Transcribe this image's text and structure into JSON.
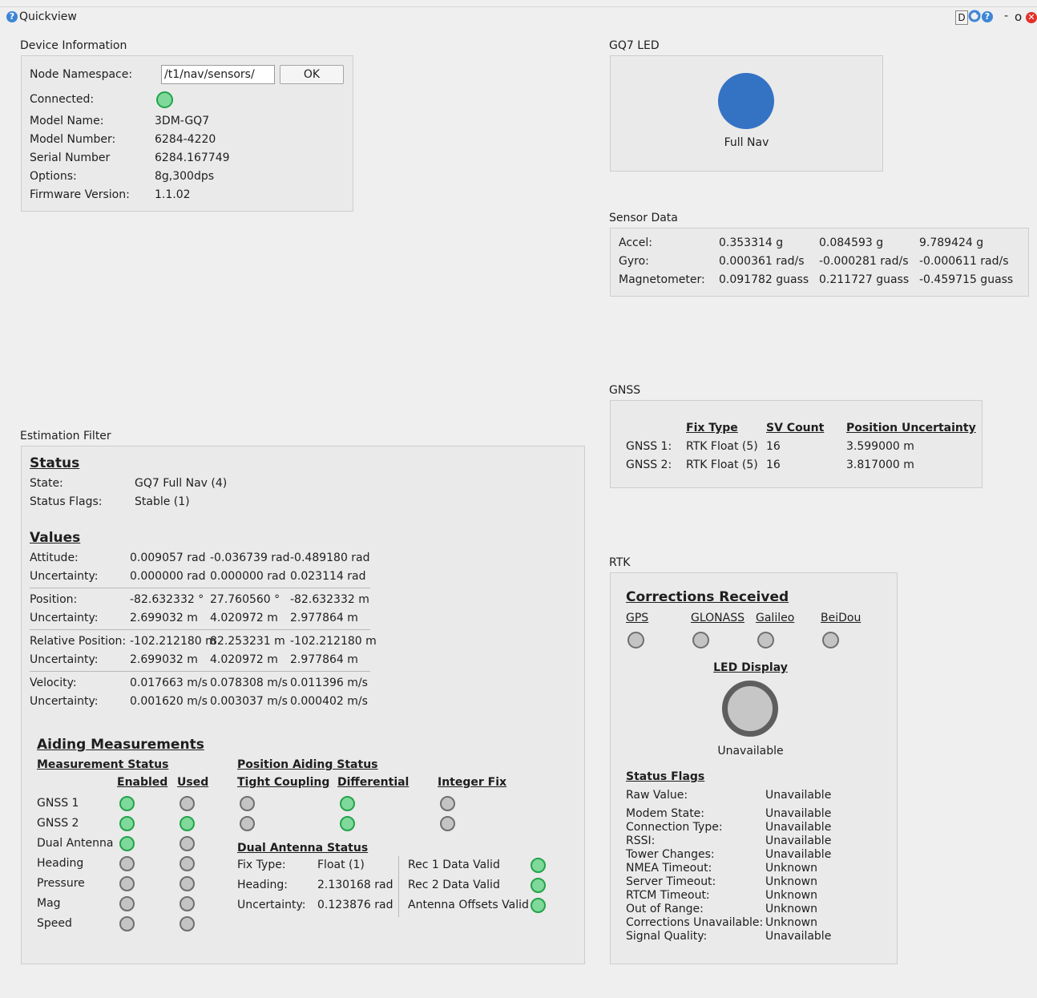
{
  "window": {
    "title": "Quickview",
    "right_label_d": "D",
    "minimize": "-",
    "restore": "o"
  },
  "device_info": {
    "group_title": "Device Information",
    "namespace_label": "Node Namespace:",
    "namespace_value": "/t1/nav/sensors/",
    "ok_label": "OK",
    "connected_label": "Connected:",
    "connected_status": "green",
    "rows": [
      {
        "label": "Model Name:",
        "value": "3DM-GQ7"
      },
      {
        "label": "Model Number:",
        "value": "6284-4220"
      },
      {
        "label": "Serial Number",
        "value": "6284.167749"
      },
      {
        "label": "Options:",
        "value": "8g,300dps"
      },
      {
        "label": "Firmware Version:",
        "value": "1.1.02"
      }
    ]
  },
  "gq7_led": {
    "group_title": "GQ7 LED",
    "color": "#3472c4",
    "label": "Full Nav"
  },
  "sensor_data": {
    "group_title": "Sensor Data",
    "rows": [
      {
        "label": "Accel:",
        "x": "0.353314 g",
        "y": "0.084593 g",
        "z": "9.789424 g"
      },
      {
        "label": "Gyro:",
        "x": "0.000361 rad/s",
        "y": "-0.000281 rad/s",
        "z": "-0.000611 rad/s"
      },
      {
        "label": "Magnetometer:",
        "x": "0.091782 guass",
        "y": "0.211727 guass",
        "z": "-0.459715 guass"
      }
    ]
  },
  "gnss": {
    "group_title": "GNSS",
    "headers": [
      "Fix Type",
      "SV Count",
      "Position Uncertainty"
    ],
    "rows": [
      {
        "label": "GNSS 1:",
        "fix": "RTK Float (5)",
        "sv": "16",
        "unc": "3.599000 m"
      },
      {
        "label": "GNSS 2:",
        "fix": "RTK Float (5)",
        "sv": "16",
        "unc": "3.817000 m"
      }
    ]
  },
  "estimation_filter": {
    "group_title": "Estimation Filter",
    "status_header": "Status",
    "state_label": "State:",
    "state_value": "GQ7 Full Nav (4)",
    "flags_label": "Status Flags:",
    "flags_value": "Stable (1)",
    "values_header": "Values",
    "rows": [
      {
        "label": "Attitude:",
        "v": [
          "0.009057 rad",
          "-0.036739 rad",
          "-0.489180 rad"
        ]
      },
      {
        "label": "Uncertainty:",
        "v": [
          "0.000000 rad",
          "0.000000 rad",
          "0.023114 rad"
        ]
      },
      {
        "label": "Position:",
        "v": [
          "-82.632332 °",
          "27.760560 °",
          "-82.632332 m"
        ]
      },
      {
        "label": "Uncertainty:",
        "v": [
          "2.699032 m",
          "4.020972 m",
          "2.977864 m"
        ]
      },
      {
        "label": "Relative Position:",
        "v": [
          "-102.212180 m",
          "82.253231 m",
          "-102.212180 m"
        ]
      },
      {
        "label": "Uncertainty:",
        "v": [
          "2.699032 m",
          "4.020972 m",
          "2.977864 m"
        ]
      },
      {
        "label": "Velocity:",
        "v": [
          "0.017663 m/s",
          "0.078308 m/s",
          "0.011396 m/s"
        ]
      },
      {
        "label": "Uncertainty:",
        "v": [
          "0.001620 m/s",
          "0.003037 m/s",
          "0.000402 m/s"
        ]
      }
    ],
    "aiding": {
      "header": "Aiding Measurements",
      "measurement_status": "Measurement Status",
      "enabled": "Enabled",
      "used": "Used",
      "position_aiding_status": "Position Aiding Status",
      "tight_coupling": "Tight Coupling",
      "differential": "Differential",
      "integer_fix": "Integer Fix",
      "rows": [
        {
          "label": "GNSS 1",
          "enabled": "green",
          "used": "gray"
        },
        {
          "label": "GNSS 2",
          "enabled": "green",
          "used": "green"
        },
        {
          "label": "Dual Antenna",
          "enabled": "green",
          "used": "gray"
        },
        {
          "label": "Heading",
          "enabled": "gray",
          "used": "gray"
        },
        {
          "label": "Pressure",
          "enabled": "gray",
          "used": "gray"
        },
        {
          "label": "Mag",
          "enabled": "gray",
          "used": "gray"
        },
        {
          "label": "Speed",
          "enabled": "gray",
          "used": "gray"
        }
      ],
      "pos_rows": [
        {
          "tight": "gray",
          "diff": "green",
          "int": "gray"
        },
        {
          "tight": "gray",
          "diff": "green",
          "int": "gray"
        }
      ],
      "dual_antenna": {
        "header": "Dual Antenna Status",
        "rows": [
          {
            "label": "Fix Type:",
            "value": "Float (1)"
          },
          {
            "label": "Heading:",
            "value": "2.130168 rad"
          },
          {
            "label": "Uncertainty:",
            "value": "0.123876 rad"
          }
        ],
        "valid_rows": [
          {
            "label": "Rec 1 Data Valid",
            "status": "green"
          },
          {
            "label": "Rec 2 Data Valid",
            "status": "green"
          },
          {
            "label": "Antenna Offsets Valid",
            "status": "green"
          }
        ]
      }
    }
  },
  "rtk": {
    "group_title": "RTK",
    "corrections_header": "Corrections Received",
    "constellations": [
      {
        "label": "GPS",
        "status": "gray"
      },
      {
        "label": "GLONASS",
        "status": "gray"
      },
      {
        "label": "Galileo",
        "status": "gray"
      },
      {
        "label": "BeiDou",
        "status": "gray"
      }
    ],
    "led_display_header": "LED Display",
    "led_display_value": "Unavailable",
    "status_flags_header": "Status Flags",
    "raw_label": "Raw Value:",
    "raw_value": "Unavailable",
    "flags": [
      {
        "label": "Modem State:",
        "value": "Unavailable"
      },
      {
        "label": "Connection Type:",
        "value": "Unavailable"
      },
      {
        "label": "RSSI:",
        "value": "Unavailable"
      },
      {
        "label": "Tower Changes:",
        "value": "Unavailable"
      },
      {
        "label": "NMEA Timeout:",
        "value": "Unknown"
      },
      {
        "label": "Server Timeout:",
        "value": "Unknown"
      },
      {
        "label": "RTCM Timeout:",
        "value": "Unknown"
      },
      {
        "label": "Out of Range:",
        "value": "Unknown"
      },
      {
        "label": "Corrections Unavailable:",
        "value": "Unknown"
      },
      {
        "label": "Signal Quality:",
        "value": "Unavailable"
      }
    ]
  }
}
